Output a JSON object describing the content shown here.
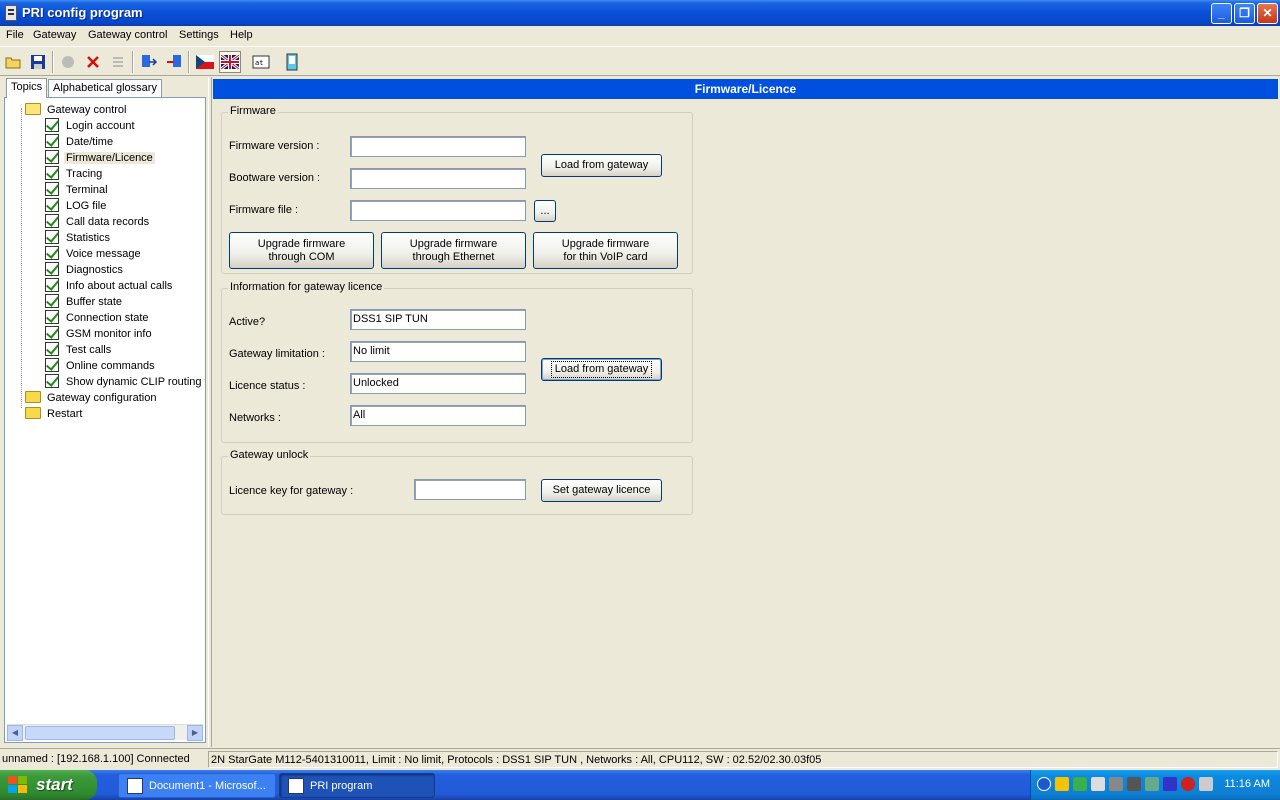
{
  "window": {
    "title": "PRI config program"
  },
  "menu": [
    "File",
    "Gateway",
    "Gateway control",
    "Settings",
    "Help"
  ],
  "tabs": [
    "Topics",
    "Alphabetical glossary"
  ],
  "tree": {
    "gateway_control": "Gateway control",
    "children": [
      "Login account",
      "Date/time",
      "Firmware/Licence",
      "Tracing",
      "Terminal",
      "LOG file",
      "Call data records",
      "Statistics",
      "Voice message",
      "Diagnostics",
      "Info about actual calls",
      "Buffer state",
      "Connection state",
      "GSM monitor info",
      "Test calls",
      "Online commands",
      "Show dynamic CLIP routing t"
    ],
    "selected": "Firmware/Licence",
    "gateway_configuration": "Gateway configuration",
    "restart": "Restart"
  },
  "header": "Firmware/Licence",
  "firmware": {
    "title": "Firmware",
    "version_label": "Firmware version :",
    "version_value": "",
    "bootware_label": "Bootware version :",
    "bootware_value": "",
    "file_label": "Firmware file :",
    "file_value": "",
    "load_button": "Load from gateway",
    "browse_button": "...",
    "upgrade_com": [
      "Upgrade firmware",
      "through COM"
    ],
    "upgrade_eth": [
      "Upgrade firmware",
      "through Ethernet"
    ],
    "upgrade_voip": [
      "Upgrade firmware",
      "for thin VoIP card"
    ]
  },
  "licence": {
    "title": "Information for gateway licence",
    "active_label": "Active?",
    "active_value": "DSS1 SIP TUN",
    "limitation_label": "Gateway limitation :",
    "limitation_value": "No limit",
    "status_label": "Licence status :",
    "status_value": "Unlocked",
    "networks_label": "Networks :",
    "networks_value": "All",
    "load_button": "Load from gateway"
  },
  "unlock": {
    "title": "Gateway unlock",
    "key_label": "Licence key for gateway :",
    "key_value": "",
    "set_button": "Set gateway licence"
  },
  "status": {
    "connection": "unnamed : [192.168.1.100] Connected",
    "info": "2N StarGate M112-5401310011, Limit : No limit, Protocols : DSS1 SIP TUN , Networks : All, CPU112, SW : 02.52/02.30.03f05"
  },
  "taskbar": {
    "start": "start",
    "tasks": [
      "Document1 - Microsof...",
      "PRI program"
    ],
    "clock": "11:16 AM"
  }
}
